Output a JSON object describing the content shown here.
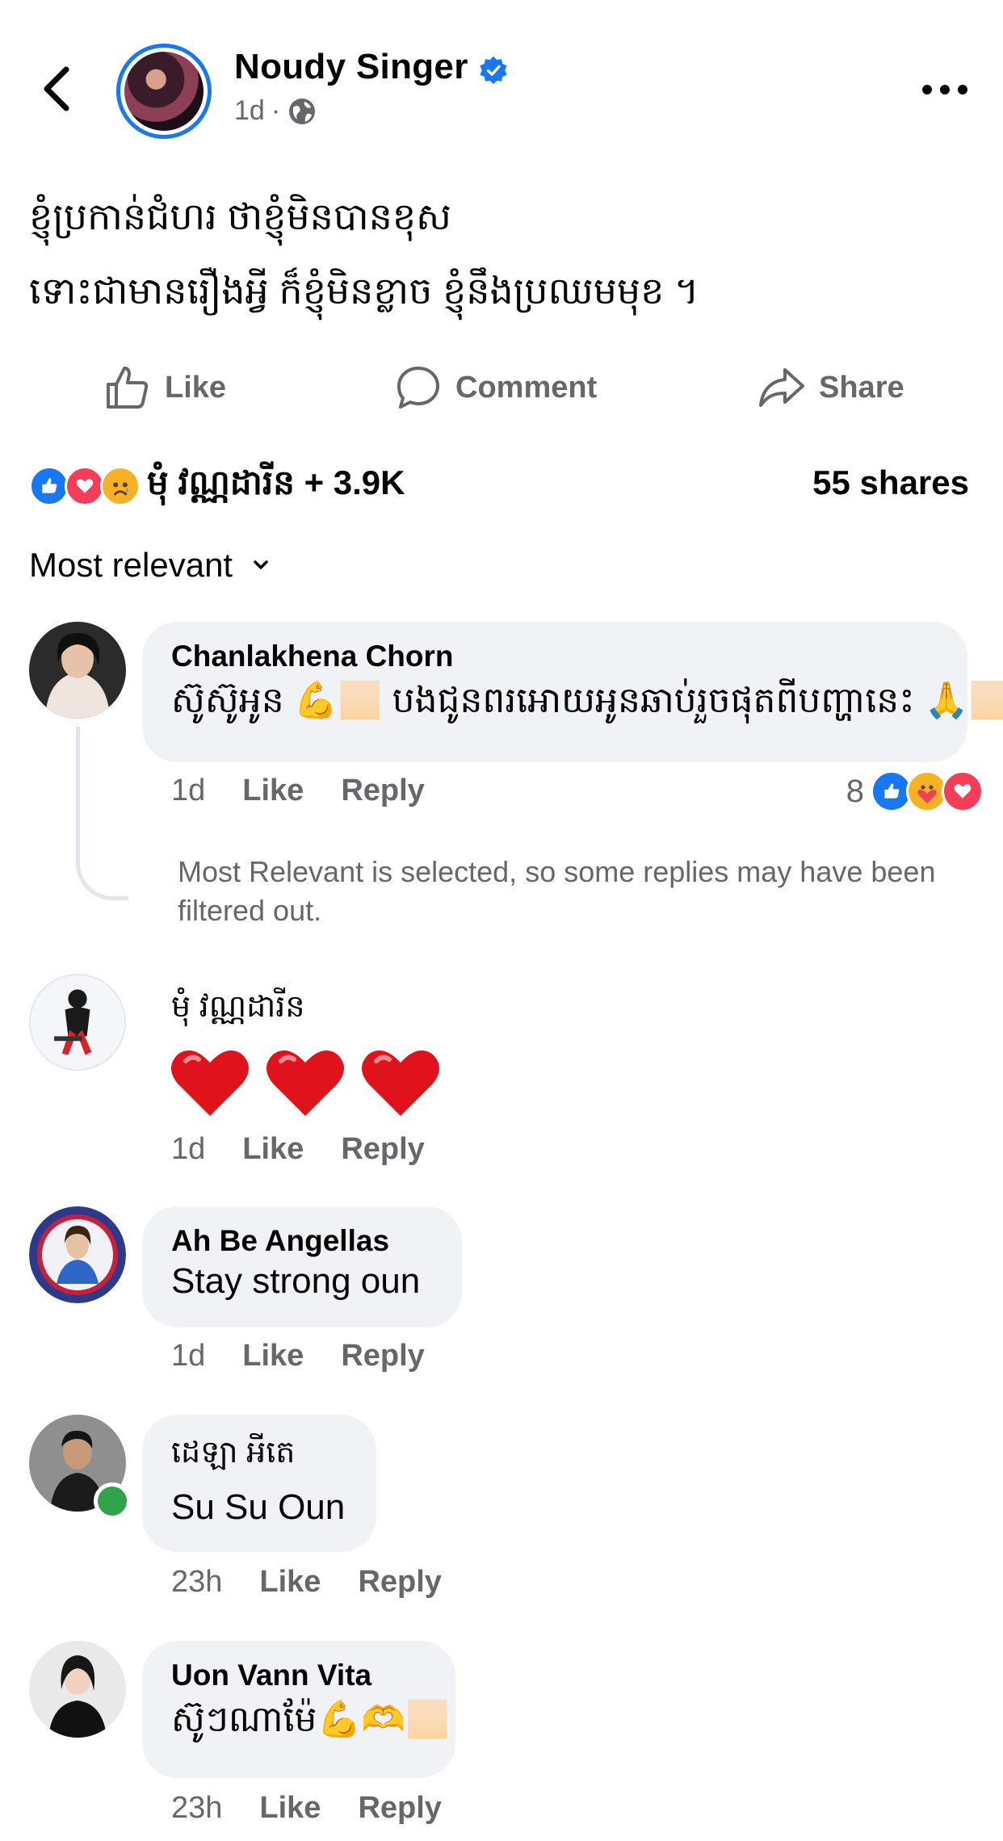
{
  "page": {
    "name": "Noudy Singer",
    "time": "1d",
    "separator": "·"
  },
  "post": {
    "lines": [
      "ខ្ញុំប្រកាន់ជំហរ ថាខ្ញុំមិនបានខុស",
      "ទោះជាមានរឿងអ្វី ក៏ខ្ញុំមិនខ្លាច ខ្ញុំនឹងប្រឈមមុខ ។"
    ]
  },
  "actions": {
    "like": "Like",
    "comment": "Comment",
    "share": "Share"
  },
  "reactions": {
    "summary": "មុំ វណ្ណដារីន + 3.9K",
    "shares": "55 shares",
    "icons": [
      "like-icon",
      "love-icon",
      "sad-icon"
    ]
  },
  "filter": {
    "label": "Most relevant"
  },
  "comments": [
    {
      "author": "Chanlakhena Chorn",
      "text": "ស៊ូស៊ូអូន 💪🏻 បងជូនពរអោយអូនឆាប់រួចផុតពីបញ្ហានេះ 🙏🏻",
      "time": "1d",
      "like": "Like",
      "reply": "Reply",
      "reaction_count": "8",
      "reaction_icons": [
        "like-icon",
        "care-icon",
        "love-icon"
      ],
      "note": "Most Relevant is selected, so some replies may have been filtered out."
    },
    {
      "author": "មុំ វណ្ណដារីន",
      "text": "❤️❤️❤️",
      "time": "1d",
      "like": "Like",
      "reply": "Reply"
    },
    {
      "author": "Ah Be Angellas",
      "text": "Stay strong oun",
      "time": "1d",
      "like": "Like",
      "reply": "Reply"
    },
    {
      "author": "ដេឡា អីតេ",
      "text": "Su Su Oun",
      "time": "23h",
      "like": "Like",
      "reply": "Reply",
      "online": true
    },
    {
      "author": "Uon Vann Vita",
      "text": "ស៊ូៗណាម៉ែ💪🫶🏻",
      "time": "23h",
      "like": "Like",
      "reply": "Reply"
    }
  ],
  "colors": {
    "brand": "#1877f2",
    "bubble": "#f0f2f5",
    "secondary_text": "#65676b",
    "online": "#31a24c"
  }
}
